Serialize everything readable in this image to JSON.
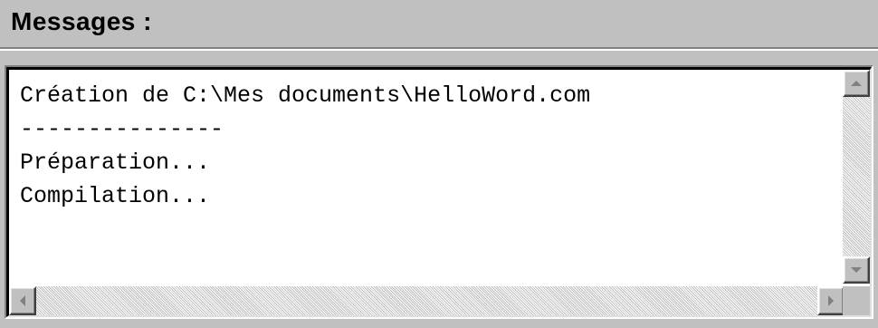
{
  "panel": {
    "title": "Messages :"
  },
  "messages": [
    "Création de C:\\Mes documents\\HelloWord.com",
    "---------------",
    "Préparation...",
    "Compilation..."
  ],
  "scrollbars": {
    "vertical": {
      "up_icon": "arrow-up-icon",
      "down_icon": "arrow-down-icon"
    },
    "horizontal": {
      "left_icon": "arrow-left-icon",
      "right_icon": "arrow-right-icon"
    }
  },
  "colors": {
    "face": "#c0c0c0",
    "text_background": "#ffffff",
    "text": "#000000",
    "disabled_arrow": "#808080"
  }
}
